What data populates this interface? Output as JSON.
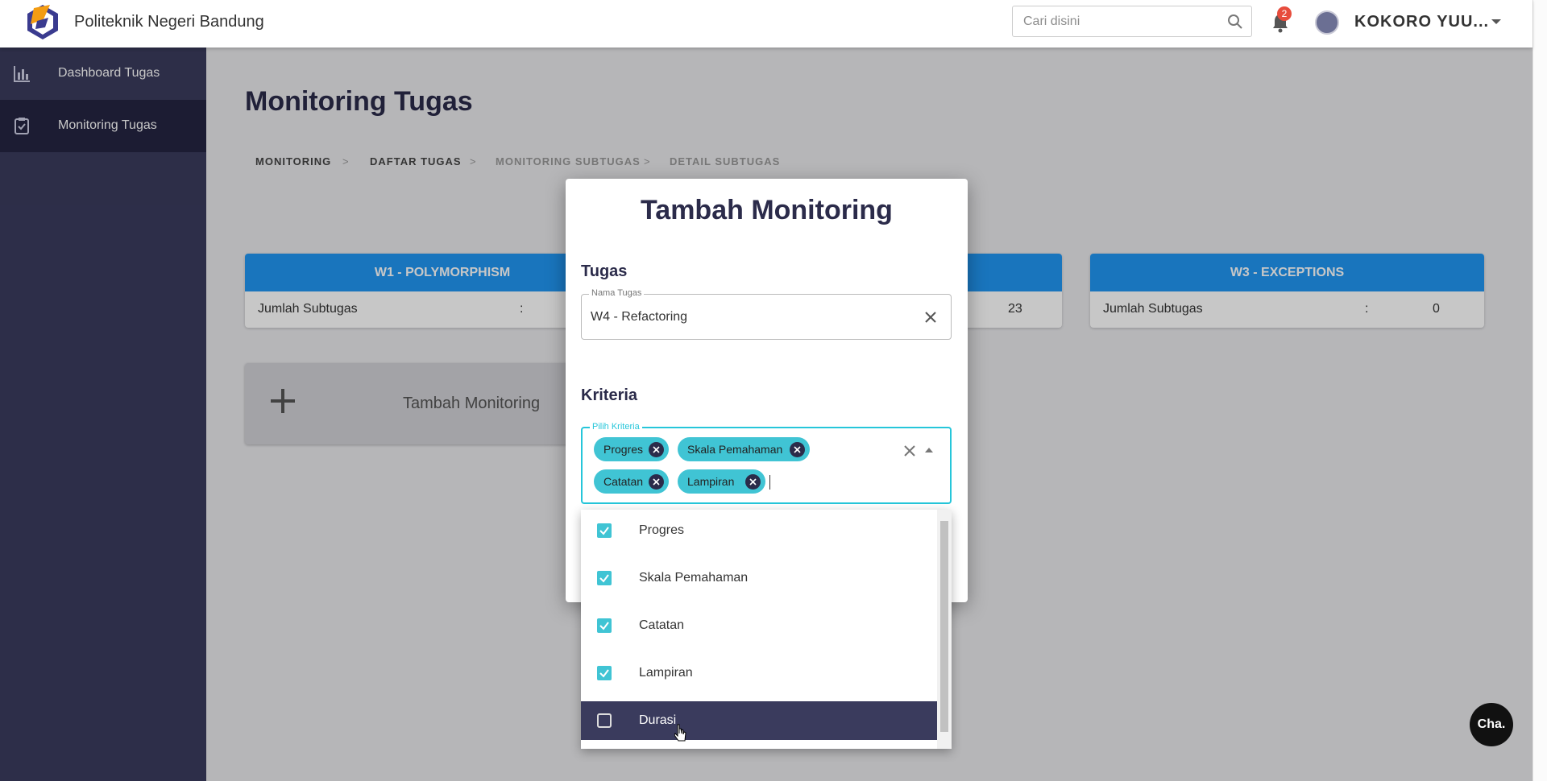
{
  "header": {
    "brand": "Politeknik Negeri Bandung",
    "search_placeholder": "Cari disini",
    "notification_count": "2",
    "username": "KOKORO YUU..."
  },
  "sidebar": {
    "items": [
      {
        "label": "Dashboard Tugas",
        "icon": "bar-chart-icon"
      },
      {
        "label": "Monitoring Tugas",
        "icon": "clipboard-check-icon"
      }
    ]
  },
  "main": {
    "title": "Monitoring Tugas",
    "breadcrumb": [
      "MONITORING",
      "DAFTAR TUGAS",
      "MONITORING SUBTUGAS",
      "DETAIL SUBTUGAS"
    ],
    "breadcrumb_separator": ">",
    "cards": [
      {
        "title": "W1 - POLYMORPHISM",
        "label": "Jumlah Subtugas",
        "sep": ":",
        "value": ""
      },
      {
        "title": "",
        "label": "",
        "sep": "",
        "value": "23"
      },
      {
        "title": "W3 - EXCEPTIONS",
        "label": "Jumlah Subtugas",
        "sep": ":",
        "value": "0"
      }
    ],
    "add_button_label": "Tambah Monitoring"
  },
  "modal": {
    "title": "Tambah Monitoring",
    "tugas_section": "Tugas",
    "nama_tugas_legend": "Nama Tugas",
    "nama_tugas_value": "W4 - Refactoring",
    "kriteria_section": "Kriteria",
    "kriteria_legend": "Pilih Kriteria",
    "chips": [
      "Progres",
      "Skala Pemahaman",
      "Catatan",
      "Lampiran"
    ]
  },
  "dropdown": {
    "options": [
      {
        "label": "Progres",
        "checked": true
      },
      {
        "label": "Skala Pemahaman",
        "checked": true
      },
      {
        "label": "Catatan",
        "checked": true
      },
      {
        "label": "Lampiran",
        "checked": true
      },
      {
        "label": "Durasi",
        "checked": false
      }
    ]
  },
  "chat_button_label": "Cha.",
  "colors": {
    "sidebar": "#3a3b5d",
    "sidebar_active": "#242442",
    "card_header": "#2196f3",
    "chip": "#40c4d4",
    "accent": "#26c6da"
  }
}
